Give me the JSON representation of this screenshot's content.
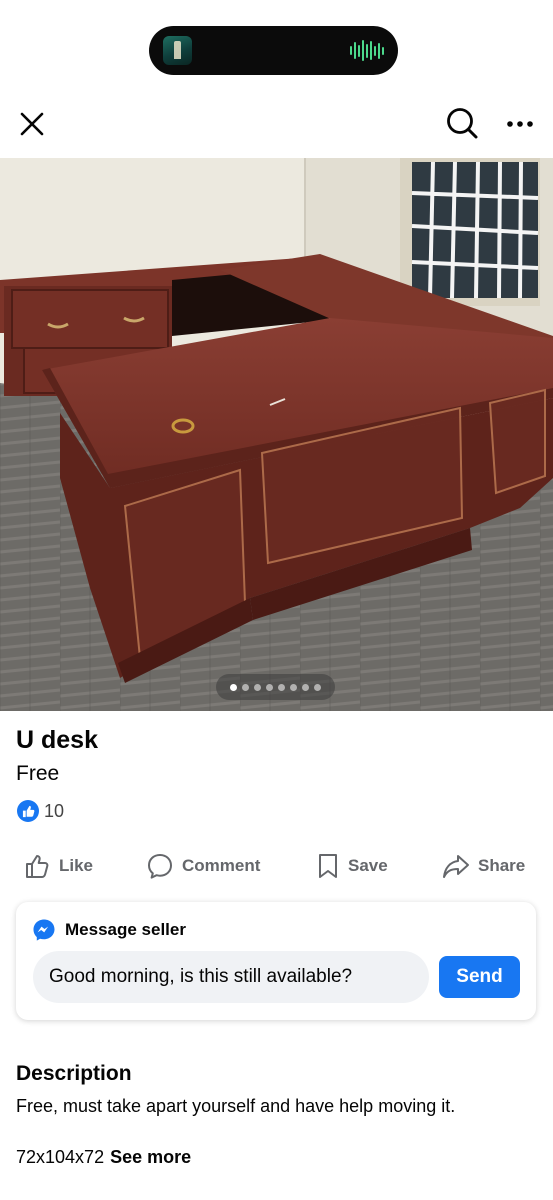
{
  "nav": {
    "close_icon": "close-icon",
    "search_icon": "search-icon",
    "more_icon": "more-horizontal-icon"
  },
  "gallery": {
    "photo": "Cherry wood U-shaped executive desk in an empty office",
    "photo_count": 8,
    "active_index": 1
  },
  "listing": {
    "title": "U desk",
    "price": "Free",
    "like_count": "10"
  },
  "actions": {
    "like": "Like",
    "comment": "Comment",
    "save": "Save",
    "share": "Share"
  },
  "message": {
    "heading": "Message seller",
    "input_value": "Good morning, is this still available?",
    "send_label": "Send"
  },
  "description": {
    "heading": "Description",
    "text": "Free, must take apart yourself and have help moving it.",
    "dimensions": "72x104x72",
    "see_more": "See more"
  },
  "colors": {
    "accent": "#1877f2",
    "secondary_text": "#65676b",
    "input_bg": "#f0f2f5"
  }
}
